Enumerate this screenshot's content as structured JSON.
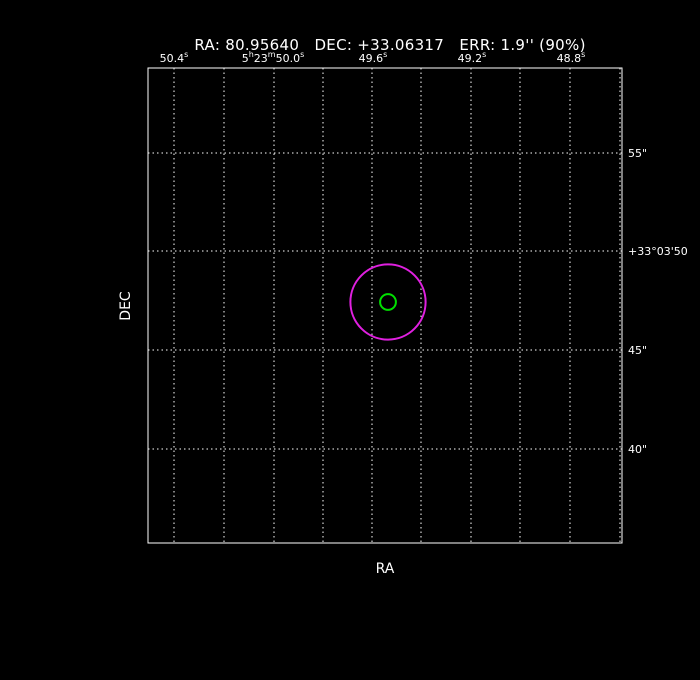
{
  "header": {
    "ra_text": "RA: 80.95640",
    "dec_text": "DEC: +33.06317",
    "err_text": "ERR: 1.9'' (90%)"
  },
  "chart_data": {
    "type": "scatter",
    "xlabel": "RA",
    "ylabel": "DEC",
    "grid": true,
    "x_ticks": [
      {
        "main": "50.4",
        "sup_unit": "s",
        "prefix": "",
        "prefix_sup": "",
        "mid": "",
        "mid_sup": ""
      },
      {
        "main": "50.0",
        "sup_unit": "s",
        "prefix": "5",
        "prefix_sup": "h",
        "mid": "23",
        "mid_sup": "m"
      },
      {
        "main": "49.6",
        "sup_unit": "s",
        "prefix": "",
        "prefix_sup": "",
        "mid": "",
        "mid_sup": ""
      },
      {
        "main": "49.2",
        "sup_unit": "s",
        "prefix": "",
        "prefix_sup": "",
        "mid": "",
        "mid_sup": ""
      },
      {
        "main": "48.8",
        "sup_unit": "s",
        "prefix": "",
        "prefix_sup": "",
        "mid": "",
        "mid_sup": ""
      }
    ],
    "y_ticks": [
      {
        "label": "55\""
      },
      {
        "label": "+33°03'50"
      },
      {
        "label": "45\""
      },
      {
        "label": "40\""
      }
    ],
    "markers": [
      {
        "name": "error-circle",
        "ra": 80.9564,
        "dec": 33.06317,
        "radius_arcsec": 1.9,
        "color": "#e020e0"
      },
      {
        "name": "source-marker",
        "ra": 80.9564,
        "dec": 33.06317,
        "radius_arcsec": 0.4,
        "color": "#00e000"
      }
    ],
    "colors": {
      "grid": "#ffffff",
      "frame": "#ffffff",
      "background": "#000000"
    }
  }
}
